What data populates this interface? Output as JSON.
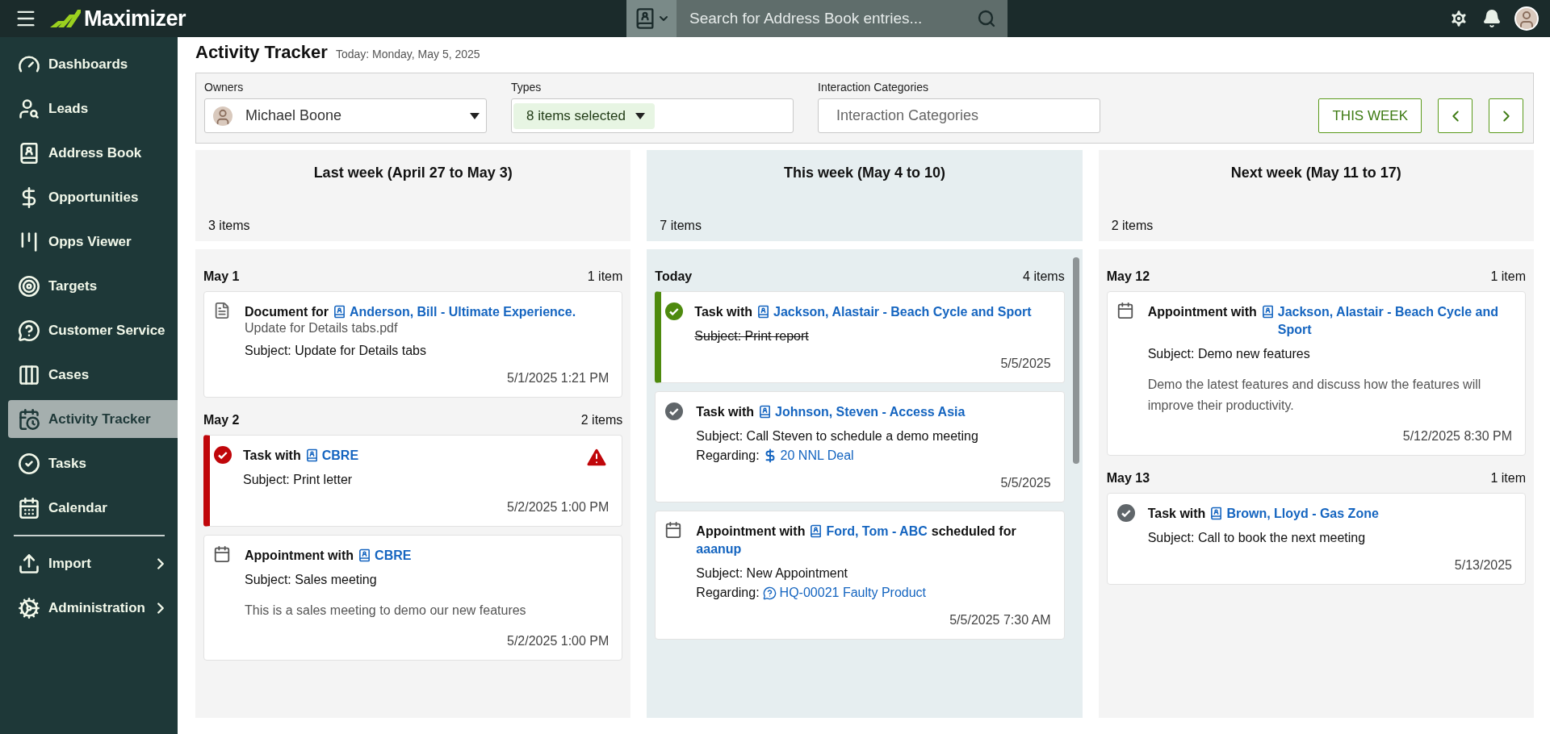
{
  "topbar": {
    "logo": "Maximizer",
    "search": {
      "placeholder": "Search for Address Book entries..."
    }
  },
  "sidebar": {
    "items": [
      {
        "label": "Dashboards",
        "selected": false,
        "submenu": false
      },
      {
        "label": "Leads",
        "selected": false,
        "submenu": false
      },
      {
        "label": "Address Book",
        "selected": false,
        "submenu": false
      },
      {
        "label": "Opportunities",
        "selected": false,
        "submenu": false
      },
      {
        "label": "Opps Viewer",
        "selected": false,
        "submenu": false
      },
      {
        "label": "Targets",
        "selected": false,
        "submenu": false
      },
      {
        "label": "Customer Service",
        "selected": false,
        "submenu": false
      },
      {
        "label": "Cases",
        "selected": false,
        "submenu": false
      },
      {
        "label": "Activity Tracker",
        "selected": true,
        "submenu": false
      },
      {
        "label": "Tasks",
        "selected": false,
        "submenu": false
      },
      {
        "label": "Calendar",
        "selected": false,
        "submenu": false
      },
      {
        "label": "Import",
        "selected": false,
        "submenu": true
      },
      {
        "label": "Administration",
        "selected": false,
        "submenu": true
      }
    ]
  },
  "page": {
    "title": "Activity Tracker",
    "today": "Today: Monday, May 5, 2025"
  },
  "filters": {
    "owners": {
      "label": "Owners",
      "value": "Michael Boone"
    },
    "types": {
      "label": "Types",
      "value": "8 items selected"
    },
    "categories": {
      "label": "Interaction Categories",
      "placeholder": "Interaction Categories"
    },
    "this_week": "THIS WEEK"
  },
  "columns": [
    {
      "title": "Last week (April 27 to May 3)",
      "count": "3 items",
      "current": false,
      "groups": [
        {
          "date": "May 1",
          "count": "1 item",
          "items": [
            {
              "kind": "document",
              "title": "Document for",
              "contact": "Anderson, Bill - Ultimate Experience.",
              "file": "Update for Details tabs.pdf",
              "subject": "Subject: Update for Details tabs",
              "date": "5/1/2025 1:21 PM"
            }
          ]
        },
        {
          "date": "May 2",
          "count": "2 items",
          "items": [
            {
              "kind": "task",
              "overdue": true,
              "done": false,
              "warning": true,
              "title": "Task with",
              "contact": "CBRE",
              "subject": "Subject: Print letter",
              "date": "5/2/2025 1:00 PM"
            },
            {
              "kind": "appointment",
              "title": "Appointment with",
              "contact": "CBRE",
              "subject": "Subject: Sales meeting",
              "description": "This is a sales meeting to demo our new features",
              "date": "5/2/2025 1:00 PM"
            }
          ]
        }
      ]
    },
    {
      "title": "This week (May 4 to 10)",
      "count": "7 items",
      "current": true,
      "groups": [
        {
          "date": "Today",
          "count": "4 items",
          "items": [
            {
              "kind": "task",
              "overdue": false,
              "done": true,
              "warning": false,
              "title": "Task with",
              "contact": "Jackson, Alastair - Beach Cycle and Sport",
              "subject": "Subject: Print report",
              "date": "5/5/2025"
            },
            {
              "kind": "task",
              "overdue": false,
              "done": false,
              "warning": false,
              "title": "Task with",
              "contact": "Johnson, Steven - Access Asia",
              "subject": "Subject: Call Steven to schedule a demo meeting",
              "regarding": {
                "label": "Regarding:",
                "kind": "opportunity",
                "text": "20 NNL Deal"
              },
              "date": "5/5/2025"
            },
            {
              "kind": "appointment",
              "title": "Appointment with",
              "contact": "Ford, Tom - ABC",
              "suffix": "scheduled for",
              "suffix_link": "aaanup",
              "subject": "Subject: New Appointment",
              "regarding": {
                "label": "Regarding:",
                "kind": "case",
                "text": "HQ-00021 Faulty Product"
              },
              "date": "5/5/2025 7:30 AM"
            }
          ]
        }
      ]
    },
    {
      "title": "Next week (May 11 to 17)",
      "count": "2 items",
      "current": false,
      "groups": [
        {
          "date": "May 12",
          "count": "1 item",
          "items": [
            {
              "kind": "appointment",
              "title": "Appointment with",
              "contact": "Jackson, Alastair - Beach Cycle and Sport",
              "subject": "Subject: Demo new features",
              "description": "Demo the latest features and discuss how the features will improve their productivity.",
              "date": "5/12/2025 8:30 PM"
            }
          ]
        },
        {
          "date": "May 13",
          "count": "1 item",
          "items": [
            {
              "kind": "task",
              "overdue": false,
              "done": false,
              "warning": false,
              "title": "Task with",
              "contact": "Brown, Lloyd - Gas Zone",
              "subject": "Subject: Call to book the next meeting",
              "date": "5/13/2025"
            }
          ]
        }
      ]
    }
  ]
}
